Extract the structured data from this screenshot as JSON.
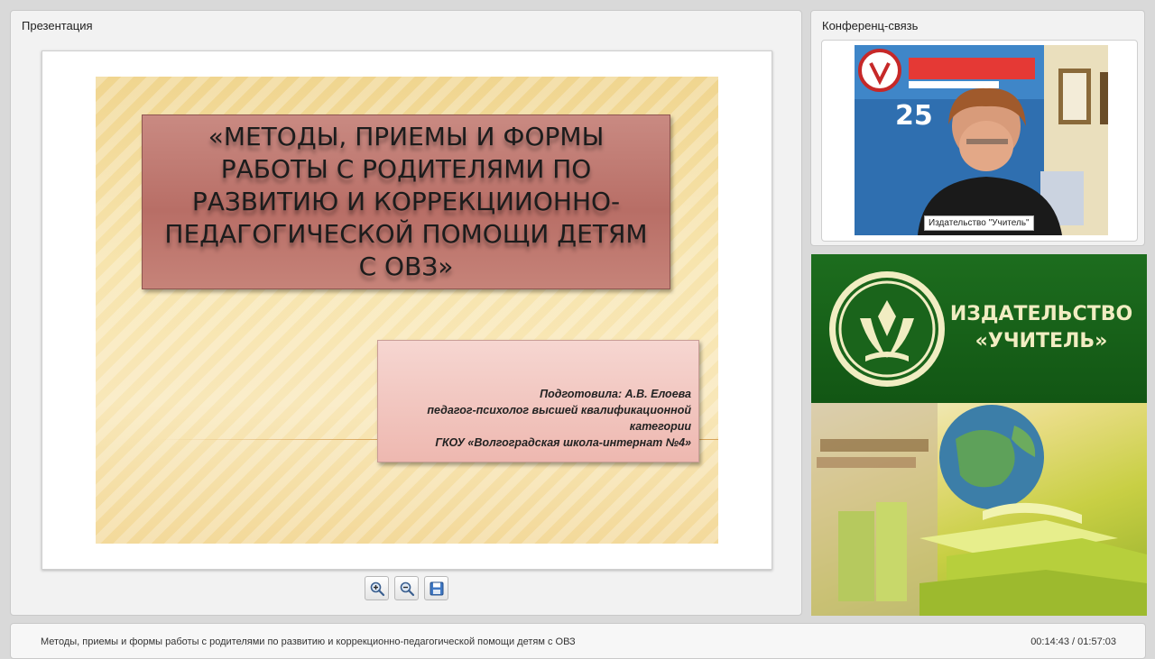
{
  "presentation_panel": {
    "title": "Презентация"
  },
  "slide": {
    "title": "«МЕТОДЫ, ПРИЕМЫ И ФОРМЫ РАБОТЫ С РОДИТЕЛЯМИ ПО РАЗВИТИЮ И КОРРЕКЦИИОННО-ПЕДАГОГИЧЕСКОЙ ПОМОЩИ ДЕТЯМ С ОВЗ»",
    "author_line1": "Подготовила: А.В. Елоева",
    "author_line2": "педагог-психолог высшей квалификационной категории",
    "author_line3": "ГКОУ «Волгоградская школа-интернат №4»"
  },
  "toolbar": {
    "zoom_in": "zoom-in-icon",
    "zoom_out": "zoom-out-icon",
    "save": "save-icon"
  },
  "conference_panel": {
    "title": "Конференц-связь",
    "video_label": "Издательство \"Учитель\""
  },
  "banner": {
    "name_line1": "ИЗДАТЕЛЬСТВО",
    "name_line2": "«УЧИТЕЛЬ»"
  },
  "footer": {
    "lecture_title": "Методы, приемы и формы работы с родителями по развитию и коррекционно-педагогической помощи детям с ОВЗ",
    "time": "00:14:43 / 01:57:03"
  }
}
